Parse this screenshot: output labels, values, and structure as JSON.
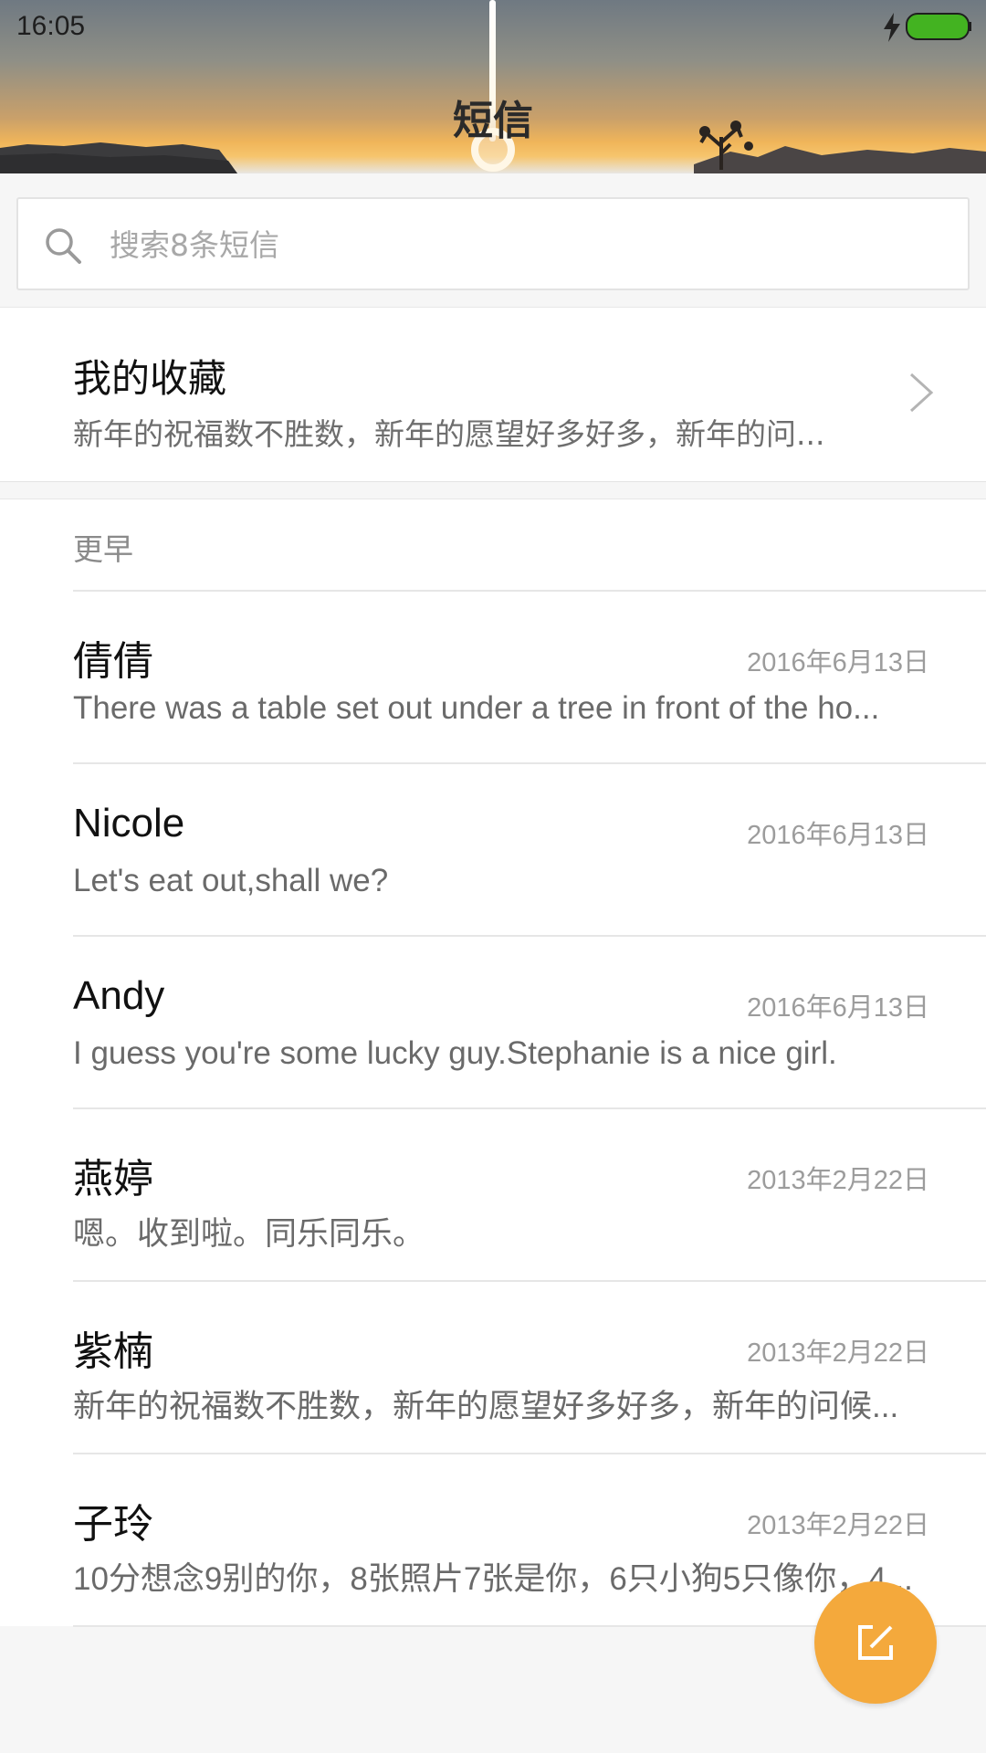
{
  "status_bar": {
    "time": "16:05",
    "charging_icon": "lightning-icon",
    "battery_icon": "battery-full-icon",
    "battery_color": "#43b321"
  },
  "header": {
    "title": "短信"
  },
  "search": {
    "icon": "search-icon",
    "placeholder": "搜索8条短信",
    "value": ""
  },
  "favorites": {
    "title": "我的收藏",
    "preview": "新年的祝福数不胜数，新年的愿望好多好多，新年的问...",
    "icon": "chevron-right-icon"
  },
  "list": {
    "section_label": "更早",
    "conversations": [
      {
        "name": "倩倩",
        "date": "2016年6月13日",
        "preview": "There was a table set out under a tree in front of the ho..."
      },
      {
        "name": "Nicole",
        "date": "2016年6月13日",
        "preview": "Let's eat out,shall we?"
      },
      {
        "name": "Andy",
        "date": "2016年6月13日",
        "preview": "I guess you're some lucky guy.Stephanie is a nice girl."
      },
      {
        "name": "燕婷",
        "date": "2013年2月22日",
        "preview": "嗯。收到啦。同乐同乐。"
      },
      {
        "name": "紫楠",
        "date": "2013年2月22日",
        "preview": "新年的祝福数不胜数，新年的愿望好多好多，新年的问候..."
      },
      {
        "name": "子玲",
        "date": "2013年2月22日",
        "preview": "10分想念9别的你，8张照片7张是你，6只小狗5只像你，4..."
      }
    ]
  },
  "fab": {
    "icon": "compose-icon",
    "color": "#f4a93c"
  }
}
